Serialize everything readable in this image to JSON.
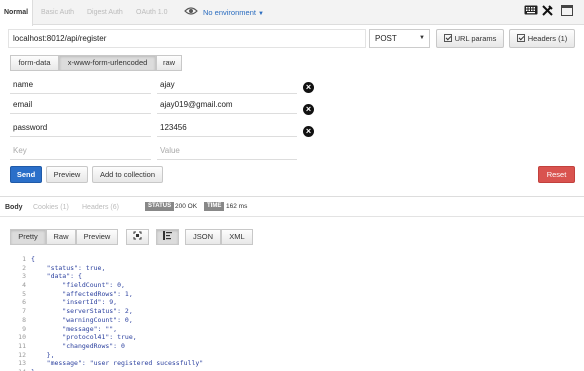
{
  "auth_tabs": [
    "Normal",
    "Basic Auth",
    "Digest Auth",
    "OAuth 1.0"
  ],
  "environment": {
    "label": "No environment"
  },
  "request": {
    "url": "localhost:8012/api/register",
    "method": "POST",
    "url_params_label": "URL params",
    "headers_label": "Headers (1)"
  },
  "body_types": [
    "form-data",
    "x-www-form-urlencoded",
    "raw"
  ],
  "params": [
    {
      "key": "name",
      "value": "ajay"
    },
    {
      "key": "email",
      "value": "ajay019@gmail.com"
    },
    {
      "key": "password",
      "value": "123456"
    }
  ],
  "new_param": {
    "key_placeholder": "Key",
    "value_placeholder": "Value"
  },
  "actions": {
    "send": "Send",
    "preview": "Preview",
    "add_to_collection": "Add to collection",
    "reset": "Reset"
  },
  "response": {
    "tabs": [
      "Body",
      "Cookies (1)",
      "Headers (6)"
    ],
    "status_label": "STATUS",
    "status_value": "200 OK",
    "time_label": "TIME",
    "time_value": "162 ms",
    "views": [
      "Pretty",
      "Raw",
      "Preview"
    ],
    "formats": [
      "JSON",
      "XML"
    ],
    "body_lines": [
      "{",
      "    \"status\": true,",
      "    \"data\": {",
      "        \"fieldCount\": 0,",
      "        \"affectedRows\": 1,",
      "        \"insertId\": 9,",
      "        \"serverStatus\": 2,",
      "        \"warningCount\": 0,",
      "        \"message\": \"\",",
      "        \"protocol41\": true,",
      "        \"changedRows\": 0",
      "    },",
      "    \"message\": \"user registered sucessfully\"",
      "}"
    ]
  },
  "colors": {
    "send": "#2a6fc9",
    "reset": "#d9534f",
    "link": "#2a6cbf",
    "json_key": "#2a3f9e"
  }
}
